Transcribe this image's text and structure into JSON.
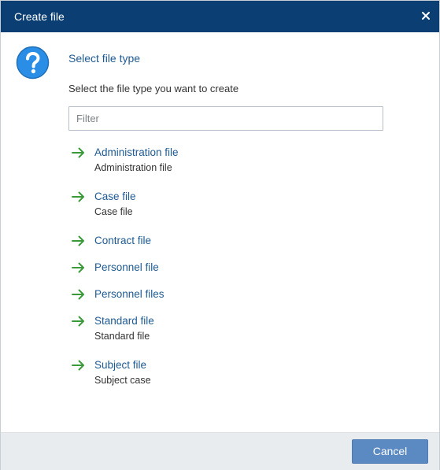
{
  "dialog": {
    "title": "Create file",
    "close_icon": "close-icon",
    "help_icon": "question-mark-icon",
    "heading": "Select file type",
    "instruction": "Select the file type you want to create",
    "filter": {
      "placeholder": "Filter",
      "value": ""
    },
    "options": [
      {
        "label": "Administration file",
        "description": "Administration file"
      },
      {
        "label": "Case file",
        "description": "Case file"
      },
      {
        "label": "Contract file",
        "description": ""
      },
      {
        "label": "Personnel file",
        "description": ""
      },
      {
        "label": "Personnel files",
        "description": ""
      },
      {
        "label": "Standard file",
        "description": "Standard file"
      },
      {
        "label": "Subject file",
        "description": "Subject case"
      }
    ],
    "cancel_label": "Cancel"
  },
  "colors": {
    "titlebar": "#0b3f73",
    "link": "#1d5a92",
    "arrow": "#3a9a3a",
    "help_icon": "#2a8ee6",
    "footer": "#e9ecef",
    "button": "#5b89c2"
  }
}
